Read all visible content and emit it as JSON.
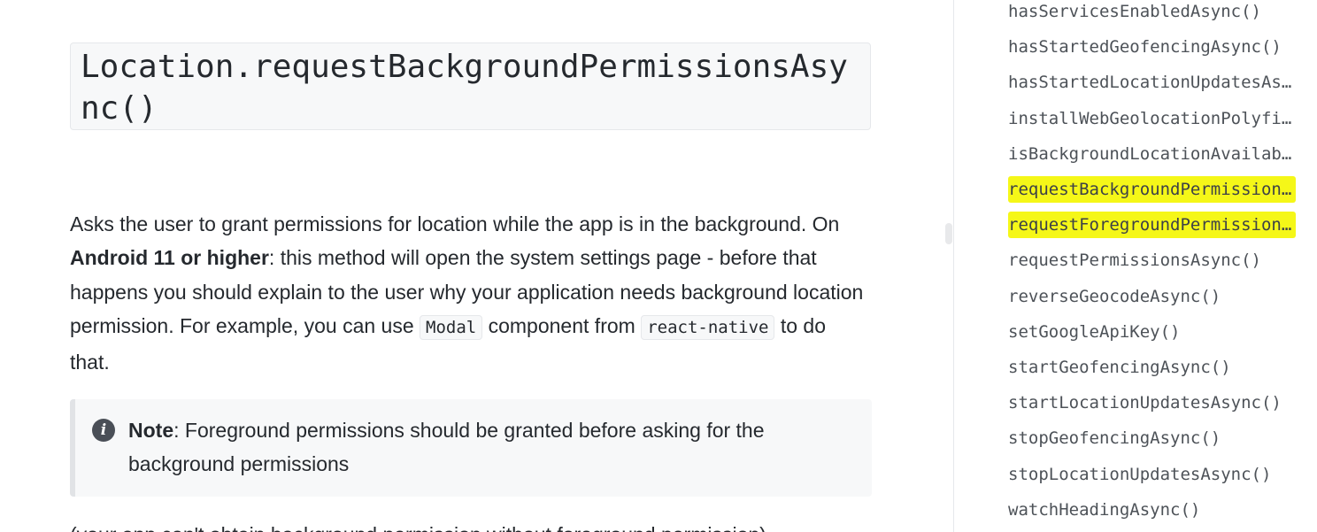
{
  "doc": {
    "method_heading": "Location.requestBackgroundPermissionsAsync()",
    "description": {
      "p1": "Asks the user to grant permissions for location while the app is in the background. On ",
      "bold": "Android 11 or higher",
      "p2": ": this method will open the system settings page - before that happens you should explain to the user why your application needs background location permission. For example, you can use ",
      "code1": "Modal",
      "p3": " component from ",
      "code2": "react-native",
      "p4": " to do that."
    },
    "note": {
      "icon": "info-icon",
      "label": "Note",
      "text": ": Foreground permissions should be granted before asking for the background permissions"
    },
    "cutoff_line": "(your app can't obtain background permission without foreground permission)."
  },
  "sidebar": {
    "items": [
      {
        "label": "hasServicesEnabledAsync()"
      },
      {
        "label": "hasStartedGeofencingAsync()"
      },
      {
        "label": "hasStartedLocationUpdatesAsync()"
      },
      {
        "label": "installWebGeolocationPolyfill()"
      },
      {
        "label": "isBackgroundLocationAvailableAsync()"
      },
      {
        "label": "requestBackgroundPermissionsAsync()"
      },
      {
        "label": "requestForegroundPermissionsAsync()"
      },
      {
        "label": "requestPermissionsAsync()"
      },
      {
        "label": "reverseGeocodeAsync()"
      },
      {
        "label": "setGoogleApiKey()"
      },
      {
        "label": "startGeofencingAsync()"
      },
      {
        "label": "startLocationUpdatesAsync()"
      },
      {
        "label": "stopGeofencingAsync()"
      },
      {
        "label": "stopLocationUpdatesAsync()"
      },
      {
        "label": "watchHeadingAsync()"
      }
    ]
  },
  "colors": {
    "highlight": "#f5f718",
    "text": "#25292e",
    "code_bg": "#f7f8f9"
  }
}
